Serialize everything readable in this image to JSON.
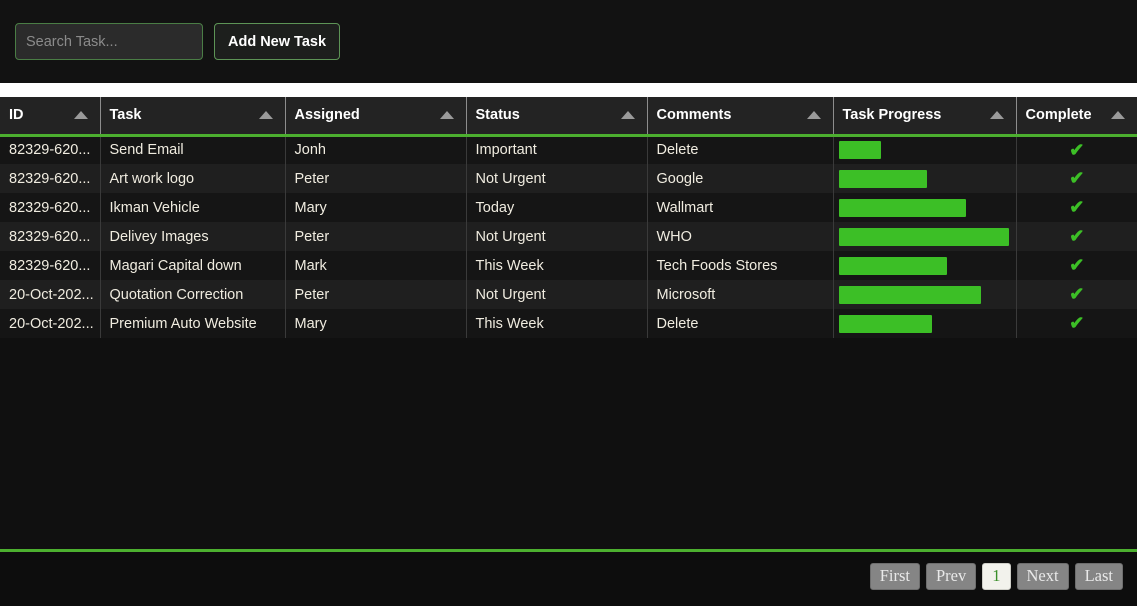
{
  "toolbar": {
    "search_placeholder": "Search Task...",
    "search_value": "",
    "add_button_label": "Add New Task"
  },
  "table": {
    "columns": [
      {
        "label": "ID",
        "sort_icon": "sort-ascending-icon"
      },
      {
        "label": "Task",
        "sort_icon": "sort-ascending-icon"
      },
      {
        "label": "Assigned",
        "sort_icon": "sort-ascending-icon"
      },
      {
        "label": "Status",
        "sort_icon": "sort-ascending-icon"
      },
      {
        "label": "Comments",
        "sort_icon": "sort-ascending-icon"
      },
      {
        "label": "Task Progress",
        "sort_icon": "sort-ascending-icon"
      },
      {
        "label": "Complete",
        "sort_icon": "sort-ascending-icon"
      }
    ],
    "rows": [
      {
        "id": "82329-620...",
        "task": "Send Email",
        "assigned": "Jonh",
        "status": "Important",
        "comments": "Delete",
        "progress": 25,
        "complete": "✔"
      },
      {
        "id": "82329-620...",
        "task": "Art work logo",
        "assigned": "Peter",
        "status": "Not Urgent",
        "comments": "Google",
        "progress": 52,
        "complete": "✔"
      },
      {
        "id": "82329-620...",
        "task": "Ikman Vehicle",
        "assigned": "Mary",
        "status": "Today",
        "comments": "Wallmart",
        "progress": 75,
        "complete": "✔"
      },
      {
        "id": "82329-620...",
        "task": "Delivey Images",
        "assigned": "Peter",
        "status": "Not Urgent",
        "comments": "WHO",
        "progress": 100,
        "complete": "✔"
      },
      {
        "id": "82329-620...",
        "task": "Magari Capital down",
        "assigned": "Mark",
        "status": "This Week",
        "comments": "Tech Foods Stores",
        "progress": 64,
        "complete": "✔"
      },
      {
        "id": "20-Oct-202...",
        "task": "Quotation Correction",
        "assigned": "Peter",
        "status": "Not Urgent",
        "comments": "Microsoft",
        "progress": 84,
        "complete": "✔"
      },
      {
        "id": "20-Oct-202...",
        "task": "Premium Auto Website",
        "assigned": "Mary",
        "status": "This Week",
        "comments": "Delete",
        "progress": 55,
        "complete": "✔"
      }
    ]
  },
  "pagination": {
    "buttons": [
      {
        "label": "First",
        "active": false
      },
      {
        "label": "Prev",
        "active": false
      },
      {
        "label": "1",
        "active": true
      },
      {
        "label": "Next",
        "active": false
      },
      {
        "label": "Last",
        "active": false
      }
    ]
  },
  "colors": {
    "accent_green": "#4caf2f",
    "bar_green": "#3cbf26",
    "page_bg": "#0d0d0d",
    "header_bg": "#232323"
  }
}
